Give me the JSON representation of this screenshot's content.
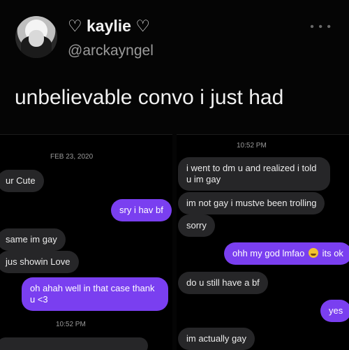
{
  "tweet": {
    "display_name": "♡ kaylie ♡",
    "handle": "@arckayngel",
    "text": "unbelievable convo i just had",
    "more_icon": "more-dots-icon"
  },
  "left_chat": {
    "date": "FEB 23, 2020",
    "messages": [
      {
        "from": "them",
        "text": "ur Cute"
      },
      {
        "from": "me",
        "text": "sry i hav bf"
      },
      {
        "from": "them",
        "text": "same im gay"
      },
      {
        "from": "them",
        "text": "jus showin Love"
      },
      {
        "from": "me",
        "text": "oh ahah well in that case thank u <3"
      }
    ],
    "time2": "10:52 PM"
  },
  "right_chat": {
    "time": "10:52 PM",
    "messages": [
      {
        "from": "them",
        "text": "i went to dm u and realized i told u im gay"
      },
      {
        "from": "them",
        "text": "im not gay i mustve been trolling"
      },
      {
        "from": "them",
        "text": "sorry"
      },
      {
        "from": "me",
        "text_before": "ohh my god lmfao",
        "emoji": "grinning-sweat-emoji",
        "text_after": "its ok"
      },
      {
        "from": "them",
        "text": "do u still have a bf"
      },
      {
        "from": "me",
        "text": "yes"
      },
      {
        "from": "them",
        "text": "im actually gay"
      }
    ]
  },
  "colors": {
    "outgoing": "#7a3ff0",
    "incoming": "#262628",
    "background": "#000000"
  }
}
